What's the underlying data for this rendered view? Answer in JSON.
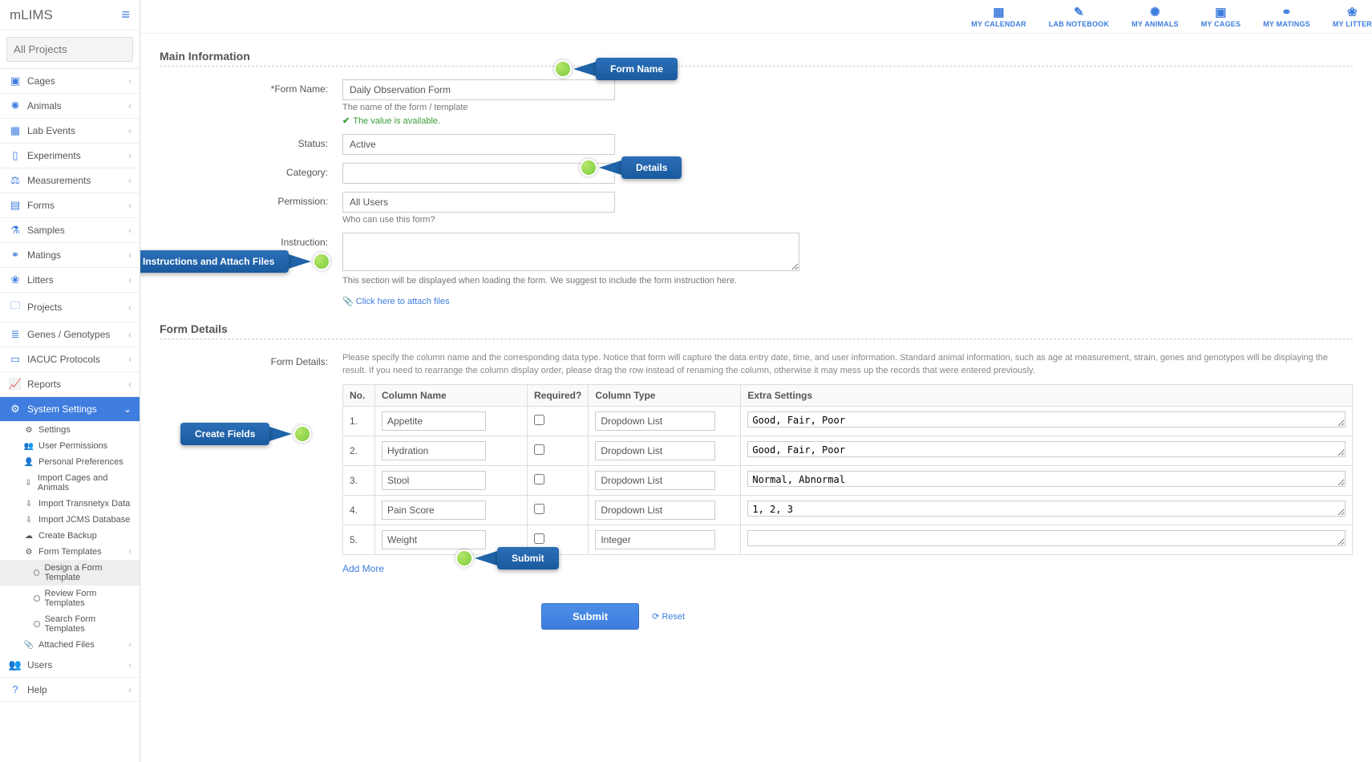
{
  "brand": "mLIMS",
  "search_placeholder": "All Projects",
  "topbar": [
    {
      "label": "MY CALENDAR"
    },
    {
      "label": "LAB NOTEBOOK"
    },
    {
      "label": "MY ANIMALS"
    },
    {
      "label": "MY CAGES"
    },
    {
      "label": "MY MATINGS"
    },
    {
      "label": "MY LITTER"
    }
  ],
  "nav": {
    "cages": "Cages",
    "animals": "Animals",
    "lab_events": "Lab Events",
    "experiments": "Experiments",
    "measurements": "Measurements",
    "forms": "Forms",
    "samples": "Samples",
    "matings": "Matings",
    "litters": "Litters",
    "projects": "Projects",
    "genes": "Genes / Genotypes",
    "iacuc": "IACUC Protocols",
    "reports": "Reports",
    "system_settings": "System Settings",
    "users": "Users",
    "help": "Help"
  },
  "sysnav": {
    "settings": "Settings",
    "user_permissions": "User Permissions",
    "personal_prefs": "Personal Preferences",
    "import_cages": "Import Cages and Animals",
    "import_transnetyx": "Import Transnetyx Data",
    "import_jcms": "Import JCMS Database",
    "create_backup": "Create Backup",
    "form_templates": "Form Templates",
    "design_form": "Design a Form Template",
    "review_form": "Review Form Templates",
    "search_form": "Search Form Templates",
    "attached_files": "Attached Files"
  },
  "sections": {
    "main": "Main Information",
    "details": "Form Details"
  },
  "labels": {
    "form_name": "*Form Name:",
    "form_name_help": "The name of the form / template",
    "available": "The value is available.",
    "status": "Status:",
    "category": "Category:",
    "permission": "Permission:",
    "permission_help": "Who can use this form?",
    "instruction": "Instruction:",
    "instruction_help": "This section will be displayed when loading the form. We suggest to include the form instruction here.",
    "attach": "Click here to attach files",
    "form_details": "Form Details:",
    "details_hint": "Please specify the column name and the corresponding data type. Notice that form will capture the data entry date, time, and user information. Standard animal information, such as age at measurement, strain, genes and genotypes will be displaying the result. If you need to rearrange the column display order, please drag the row instead of renaming the column, otherwise it may mess up the records that were entered previously.",
    "add_more": "Add More",
    "submit": "Submit",
    "reset": "Reset"
  },
  "values": {
    "form_name": "Daily Observation Form",
    "status": "Active",
    "category": "",
    "permission": "All Users",
    "instruction": ""
  },
  "table": {
    "headers": {
      "no": "No.",
      "colname": "Column Name",
      "required": "Required?",
      "coltype": "Column Type",
      "extra": "Extra Settings"
    },
    "rows": [
      {
        "no": "1.",
        "name": "Appetite",
        "type": "Dropdown List",
        "extra": "Good, Fair, Poor"
      },
      {
        "no": "2.",
        "name": "Hydration",
        "type": "Dropdown List",
        "extra": "Good, Fair, Poor"
      },
      {
        "no": "3.",
        "name": "Stool",
        "type": "Dropdown List",
        "extra": "Normal, Abnormal"
      },
      {
        "no": "4.",
        "name": "Pain Score",
        "type": "Dropdown List",
        "extra": "1, 2, 3"
      },
      {
        "no": "5.",
        "name": "Weight",
        "type": "Integer",
        "extra": ""
      }
    ]
  },
  "callouts": {
    "form_name": "Form Name",
    "details": "Details",
    "instructions": "Instructions and Attach Files",
    "create_fields": "Create Fields",
    "submit": "Submit"
  }
}
